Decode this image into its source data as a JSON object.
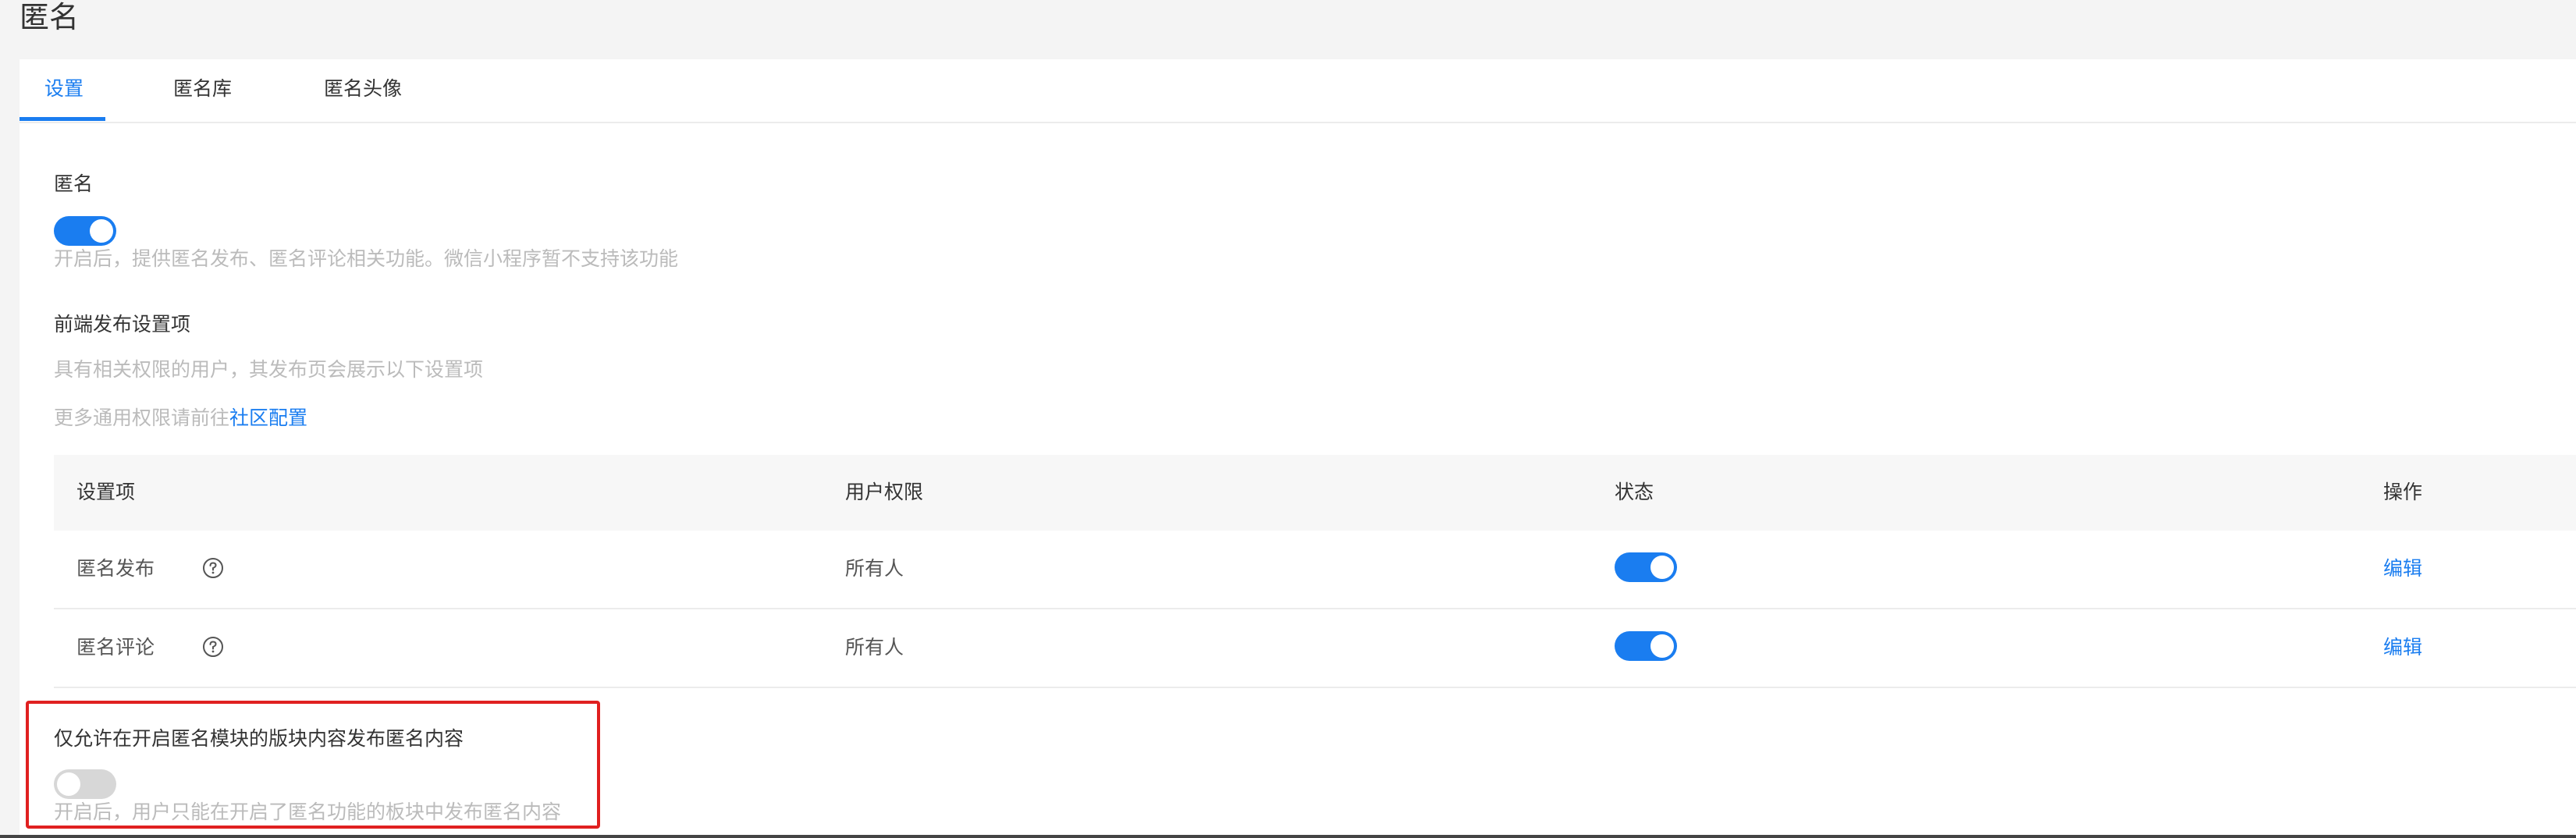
{
  "page": {
    "title": "匿名"
  },
  "tabs": [
    {
      "label": "设置",
      "active": true
    },
    {
      "label": "匿名库",
      "active": false
    },
    {
      "label": "匿名头像",
      "active": false
    }
  ],
  "anonymous": {
    "label": "匿名",
    "enabled": true,
    "hint": "开启后，提供匿名发布、匿名评论相关功能。微信小程序暂不支持该功能"
  },
  "frontend": {
    "label": "前端发布设置项",
    "hint": "具有相关权限的用户，其发布页会展示以下设置项",
    "more_prefix": "更多通用权限请前往",
    "more_link": "社区配置"
  },
  "table": {
    "headers": [
      "设置项",
      "用户权限",
      "状态",
      "操作"
    ],
    "rows": [
      {
        "name": "匿名发布",
        "permission": "所有人",
        "status": true,
        "action": "编辑"
      },
      {
        "name": "匿名评论",
        "permission": "所有人",
        "status": true,
        "action": "编辑"
      }
    ]
  },
  "restrict": {
    "label": "仅允许在开启匿名模块的版块内容发布匿名内容",
    "enabled": false,
    "hint": "开启后，用户只能在开启了匿名功能的板块中发布匿名内容"
  },
  "colors": {
    "accent": "#1a7df0",
    "highlight": "#e02020",
    "toggle_off": "#d7d7d7"
  },
  "icons": {
    "help": "question-circle-icon"
  }
}
